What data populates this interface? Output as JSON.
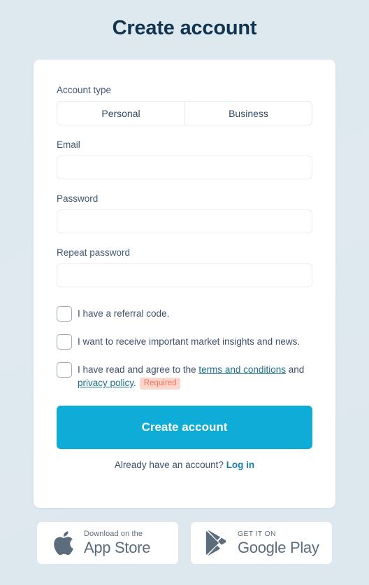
{
  "page": {
    "title": "Create account",
    "background_color": "#dfe9ef",
    "accent_color": "#0facd8",
    "link_color": "#1b6f8c",
    "title_color": "#113551"
  },
  "form": {
    "account_type": {
      "label": "Account type",
      "options": [
        "Personal",
        "Business"
      ]
    },
    "email": {
      "label": "Email",
      "value": "",
      "placeholder": ""
    },
    "password": {
      "label": "Password",
      "value": "",
      "placeholder": ""
    },
    "repeat_password": {
      "label": "Repeat password",
      "value": "",
      "placeholder": ""
    },
    "checkboxes": [
      {
        "text": "I have a referral code.",
        "checked": false
      },
      {
        "text": "I want to receive important market insights and news.",
        "checked": false
      },
      {
        "checked": false,
        "prefix": "I have read and agree to the ",
        "link1": "terms and conditions",
        "middle": " and ",
        "link2": "privacy policy",
        "suffix": ".",
        "badge": "Required",
        "badge_bg": "#fbd6cd",
        "badge_color": "#f2715a"
      }
    ],
    "submit_label": "Create account",
    "login_prompt": "Already have an account?",
    "login_link": "Log in"
  },
  "stores": {
    "apple": {
      "top_line": "Download on the",
      "bottom_line": "App Store",
      "icon": "apple-logo-icon"
    },
    "google": {
      "top_line": "GET IT ON",
      "bottom_line": "Google Play",
      "icon": "google-play-triangle-icon"
    }
  }
}
